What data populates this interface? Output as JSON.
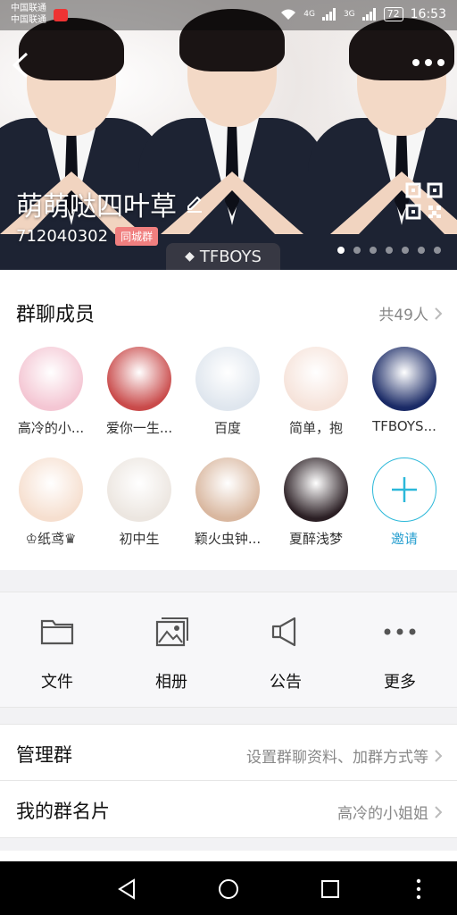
{
  "status_bar": {
    "carrier_line1": "中国联通",
    "carrier_line2": "中国联通",
    "network_1": "4G",
    "network_2": "3G",
    "battery": "72",
    "time": "16:53"
  },
  "header": {
    "group_name": "萌萌哒四叶草",
    "group_id": "712040302",
    "city_badge": "同城群",
    "watermark": "TFBOYS",
    "page_count": 7,
    "active_page": 1
  },
  "members": {
    "title": "群聊成员",
    "count_label": "共49人",
    "list": [
      {
        "name": "高冷的小...",
        "avatar_color": "#f4c6d3"
      },
      {
        "name": "爱你一生...",
        "avatar_color": "#c94a4a"
      },
      {
        "name": "百度",
        "avatar_color": "#dfe6ee"
      },
      {
        "name": "简单，抱",
        "avatar_color": "#f6e3da"
      },
      {
        "name": "TFBOYS...",
        "avatar_color": "#1a2a66"
      },
      {
        "name": "♔纸鸢♛",
        "avatar_color": "#f6dfcf"
      },
      {
        "name": "初中生",
        "avatar_color": "#ece6e0"
      },
      {
        "name": "颖火虫钟...",
        "avatar_color": "#d9b79f"
      },
      {
        "name": "夏醉浅梦",
        "avatar_color": "#2b1f24"
      }
    ],
    "invite_label": "邀请"
  },
  "actions": [
    {
      "label": "文件",
      "icon": "folder-icon"
    },
    {
      "label": "相册",
      "icon": "photo-album-icon"
    },
    {
      "label": "公告",
      "icon": "megaphone-icon"
    },
    {
      "label": "更多",
      "icon": "more-dots-icon"
    }
  ],
  "rows": {
    "manage": {
      "title": "管理群",
      "value": "设置群聊资料、加群方式等"
    },
    "card": {
      "title": "我的群名片",
      "value": "高冷的小姐姐"
    }
  },
  "colors": {
    "accent": "#2bb8d9",
    "badge": "#f07f7f"
  }
}
